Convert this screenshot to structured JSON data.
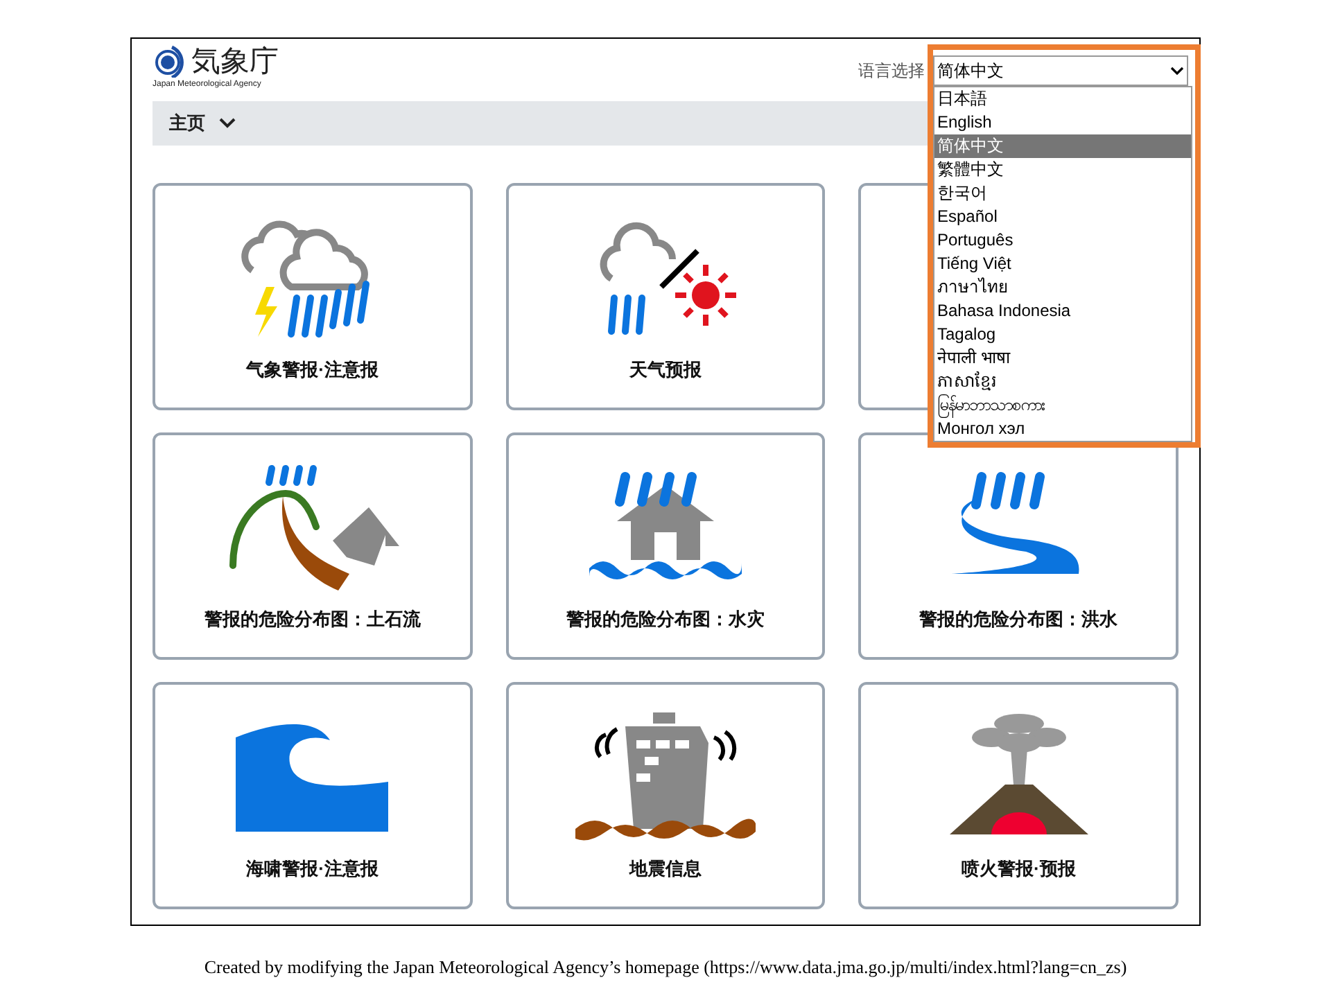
{
  "header": {
    "logo_text": "気象庁",
    "logo_subtext": "Japan Meteorological Agency",
    "language_label": "语言选择"
  },
  "language_select": {
    "value": "简体中文",
    "expanded": true,
    "options": [
      {
        "label": "日本語",
        "selected": false
      },
      {
        "label": "English",
        "selected": false
      },
      {
        "label": "简体中文",
        "selected": true
      },
      {
        "label": "繁體中文",
        "selected": false
      },
      {
        "label": "한국어",
        "selected": false
      },
      {
        "label": "Español",
        "selected": false
      },
      {
        "label": "Português",
        "selected": false
      },
      {
        "label": "Tiếng Việt",
        "selected": false
      },
      {
        "label": "ภาษาไทย",
        "selected": false
      },
      {
        "label": "Bahasa Indonesia",
        "selected": false
      },
      {
        "label": "Tagalog",
        "selected": false
      },
      {
        "label": "नेपाली भाषा",
        "selected": false
      },
      {
        "label": "ភាសាខ្មែរ",
        "selected": false
      },
      {
        "label": "မြန်မာဘာသာစကား",
        "selected": false
      },
      {
        "label": "Монгол хэл",
        "selected": false
      }
    ]
  },
  "nav": {
    "label": "主页"
  },
  "cards": [
    {
      "kind": "storm",
      "label": "气象警报·注意报"
    },
    {
      "kind": "forecast",
      "label": "天气预报"
    },
    {
      "kind": "covered"
    },
    {
      "kind": "landslide",
      "label": "警报的危险分布图：土石流"
    },
    {
      "kind": "inundation",
      "label": "警报的危险分布图：水灾"
    },
    {
      "kind": "flood",
      "label": "警报的危险分布图：洪水"
    },
    {
      "kind": "tsunami",
      "label": "海啸警报·注意报"
    },
    {
      "kind": "earthquake",
      "label": "地震信息"
    },
    {
      "kind": "volcano",
      "label": "喷火警报·预报"
    }
  ],
  "caption": "Created by modifying the Japan Meteorological Agency’s homepage (https://www.data.jma.go.jp/multi/index.html?lang=cn_zs)"
}
